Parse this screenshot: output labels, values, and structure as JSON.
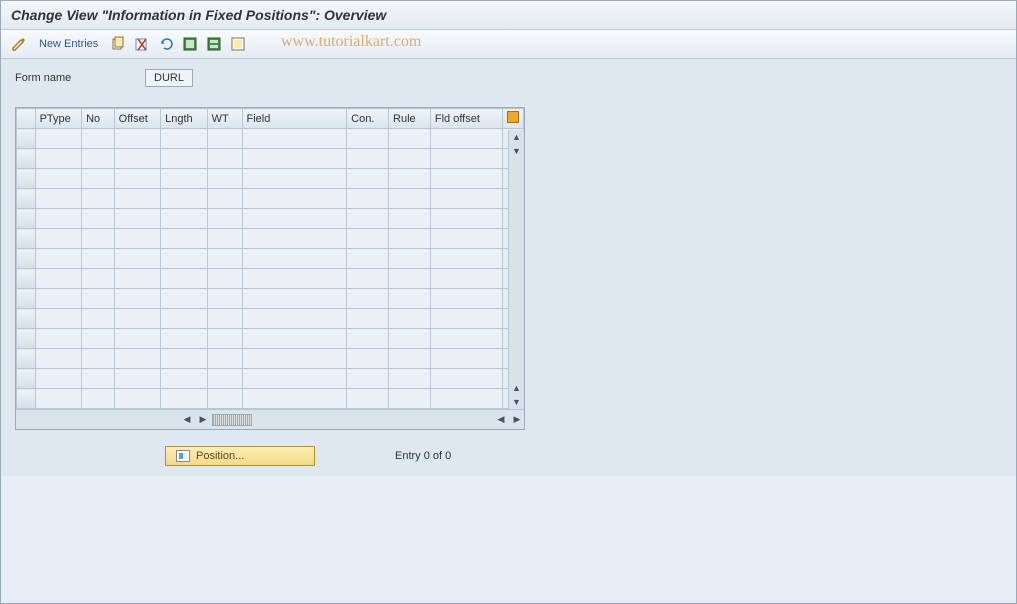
{
  "title": "Change View \"Information in Fixed Positions\": Overview",
  "toolbar": {
    "new_entries_label": "New Entries"
  },
  "watermark": "www.tutorialkart.com",
  "form": {
    "form_name_label": "Form name",
    "form_name_value": "DURL"
  },
  "grid": {
    "columns": [
      "PType",
      "No",
      "Offset",
      "Lngth",
      "WT",
      "Field",
      "Con.",
      "Rule",
      "Fld offset"
    ],
    "rows": 14
  },
  "footer": {
    "position_button_label": "Position...",
    "entry_text": "Entry 0 of 0"
  }
}
